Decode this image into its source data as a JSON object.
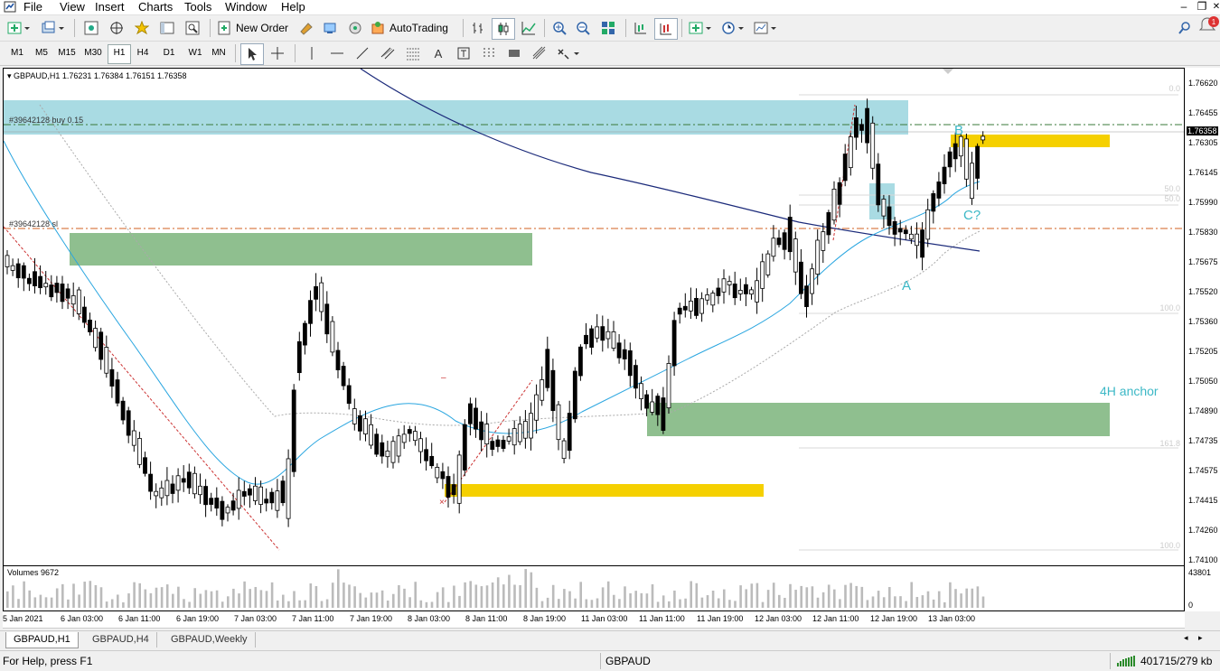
{
  "menu": {
    "items": [
      "File",
      "View",
      "Insert",
      "Charts",
      "Tools",
      "Window",
      "Help"
    ]
  },
  "toolbar": {
    "new_order": "New Order",
    "autotrading": "AutoTrading"
  },
  "timeframes": [
    "M1",
    "M5",
    "M15",
    "M30",
    "H1",
    "H4",
    "D1",
    "W1",
    "MN"
  ],
  "active_timeframe": "H1",
  "notification_count": "1",
  "chart": {
    "header": "GBPAUD,H1  1.76231 1.76384 1.76151 1.76358",
    "order_line_label": "#39642128 buy 0.15",
    "sl_line_label": "#39642128 sl",
    "current_price": "1.76358",
    "annotations": {
      "a": "A",
      "b": "B",
      "c": "C?",
      "anchor": "4H anchor"
    },
    "fib_labels": [
      "0.0",
      "50.0",
      "50.0",
      "100.0",
      "161.8",
      "100.0"
    ],
    "price_labels": [
      "1.76620",
      "1.76455",
      "1.76305",
      "1.76145",
      "1.75990",
      "1.75830",
      "1.75675",
      "1.75520",
      "1.75360",
      "1.75205",
      "1.75050",
      "1.74890",
      "1.74735",
      "1.74575",
      "1.74415",
      "1.74260",
      "1.74100"
    ]
  },
  "volumes": {
    "label": "Volumes 9672",
    "max_label": "43801",
    "min_label": "0"
  },
  "time_labels": [
    "5 Jan 2021",
    "6 Jan 03:00",
    "6 Jan 11:00",
    "6 Jan 19:00",
    "7 Jan 03:00",
    "7 Jan 11:00",
    "7 Jan 19:00",
    "8 Jan 03:00",
    "8 Jan 11:00",
    "8 Jan 19:00",
    "11 Jan 03:00",
    "11 Jan 11:00",
    "11 Jan 19:00",
    "12 Jan 03:00",
    "12 Jan 11:00",
    "12 Jan 19:00",
    "13 Jan 03:00"
  ],
  "tabs": [
    "GBPAUD,H1",
    "GBPAUD,H4",
    "GBPAUD,Weekly"
  ],
  "status": {
    "help": "For Help, press F1",
    "symbol": "GBPAUD",
    "traffic": "401715/279 kb"
  },
  "colors": {
    "zone_blue": "#a9dbe3",
    "zone_green": "#8fbf8f",
    "zone_yellow": "#f5d000",
    "annotation": "#3cb8c6"
  }
}
